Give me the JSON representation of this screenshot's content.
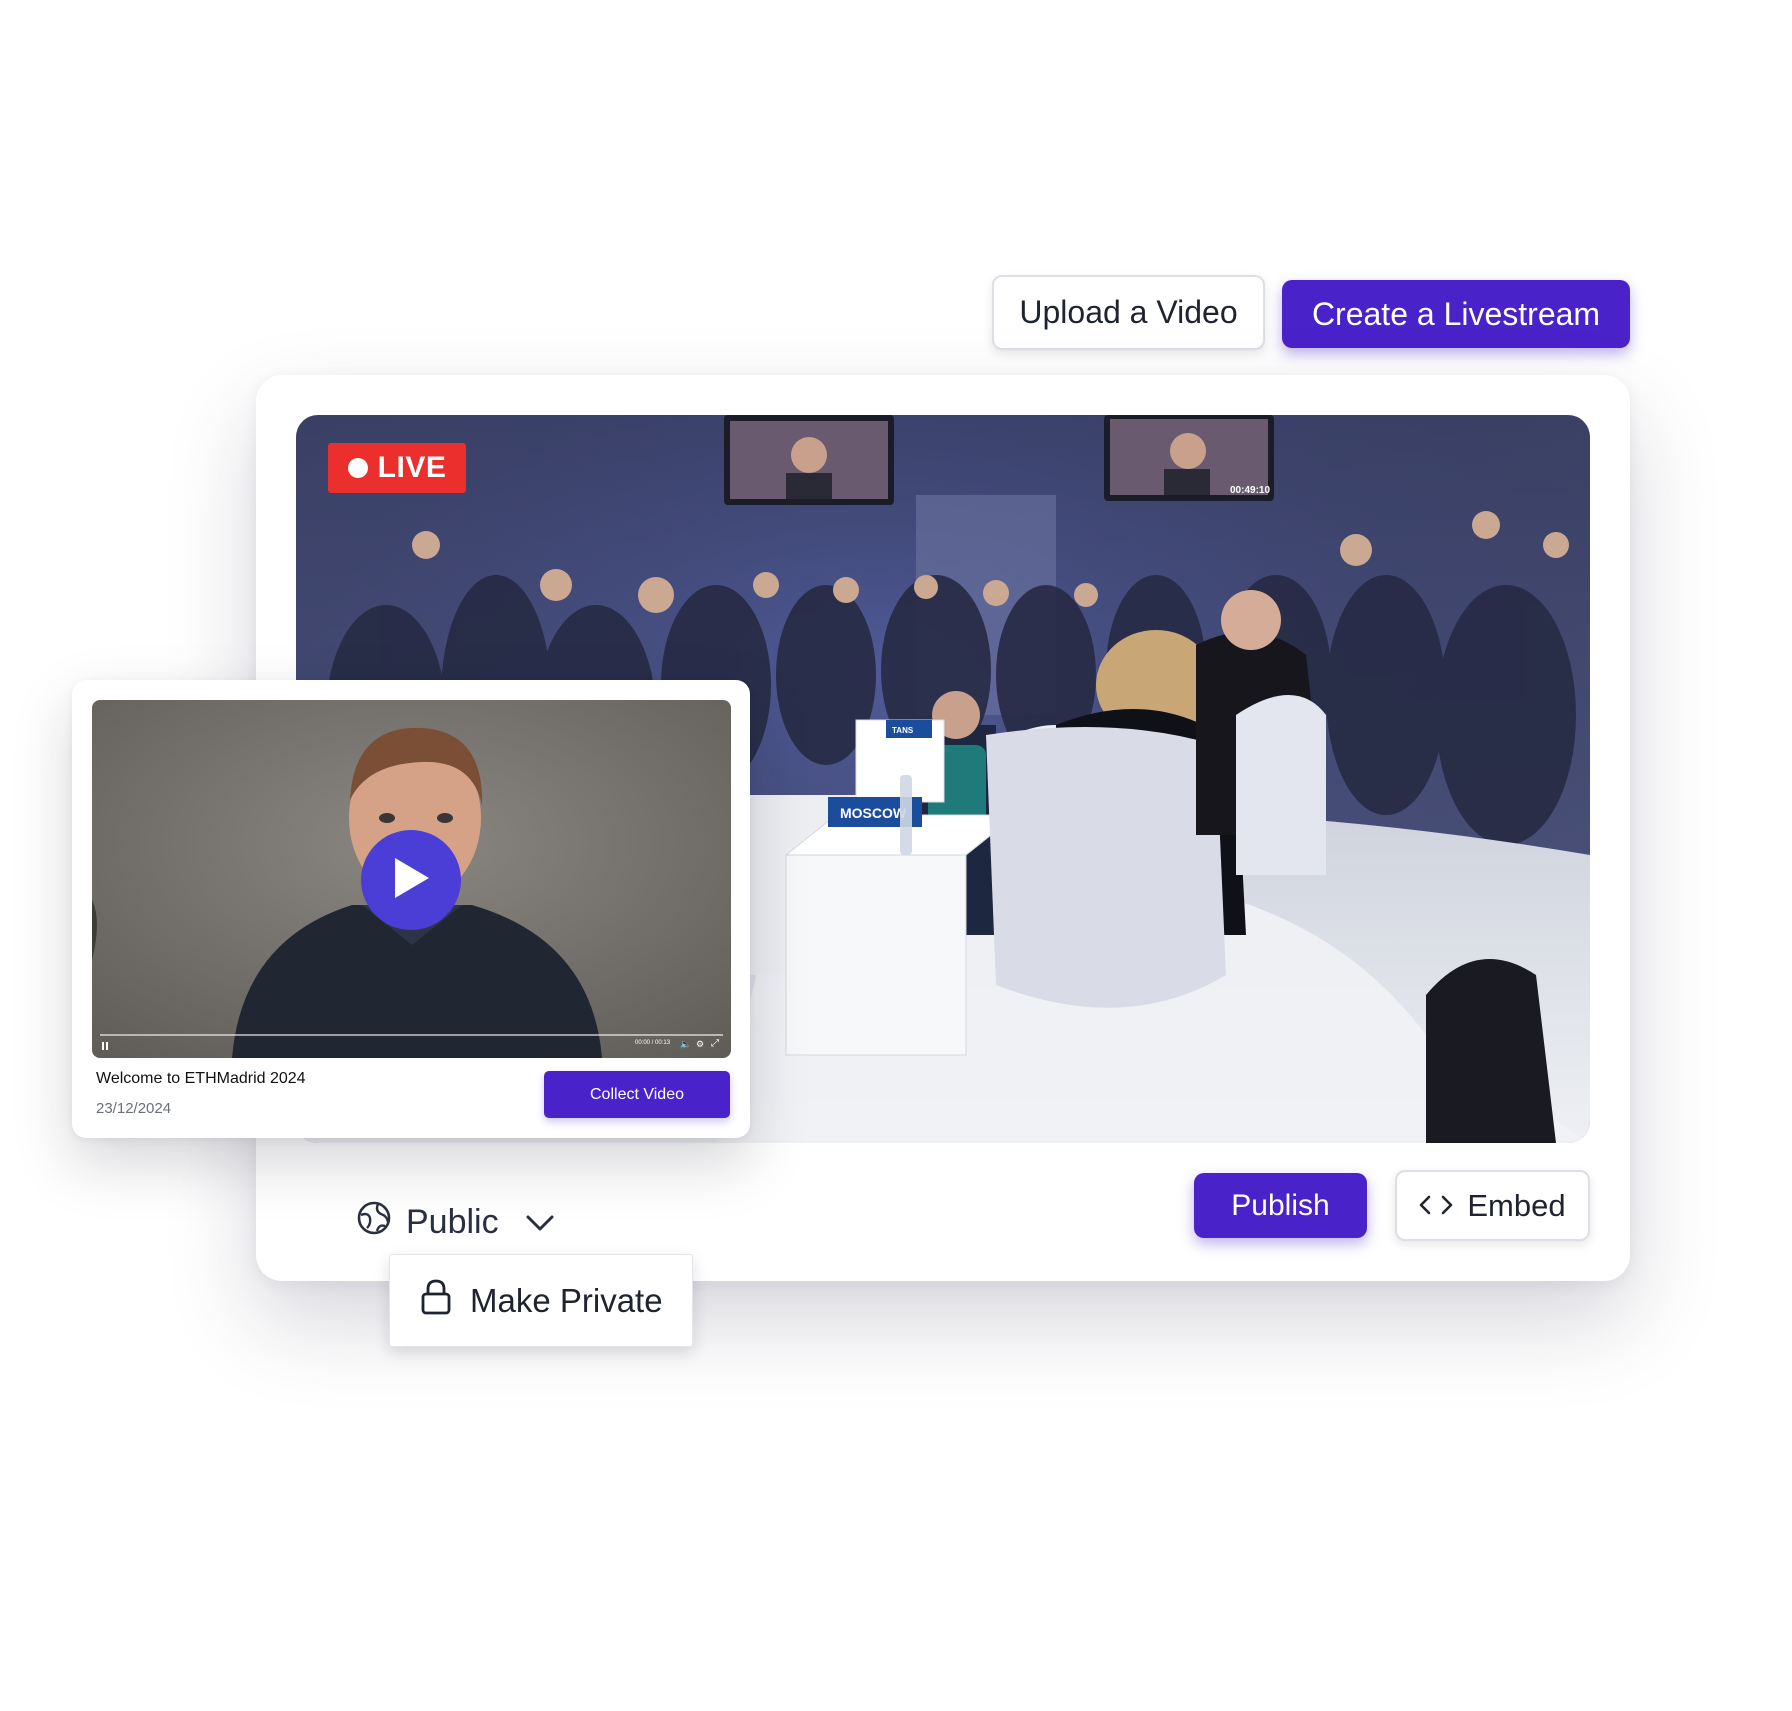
{
  "toolbar": {
    "upload_label": "Upload a Video",
    "livestream_label": "Create a Livestream"
  },
  "stream": {
    "live_label": "LIVE",
    "overlay_time": "00:49:10",
    "tag_left": "TANS",
    "tag_center": "MOSCOW"
  },
  "video_card": {
    "title": "Welcome to ETHMadrid 2024",
    "date": "23/12/2024",
    "collect_label": "Collect Video",
    "time_display": "00:00 / 00:13",
    "progress": 0
  },
  "visibility": {
    "selected": "Public",
    "menu_item": "Make Private"
  },
  "actions": {
    "publish_label": "Publish",
    "embed_label": "Embed"
  },
  "colors": {
    "accent": "#4a22c9",
    "live": "#ea2f2c",
    "play": "#4a3ed6"
  }
}
